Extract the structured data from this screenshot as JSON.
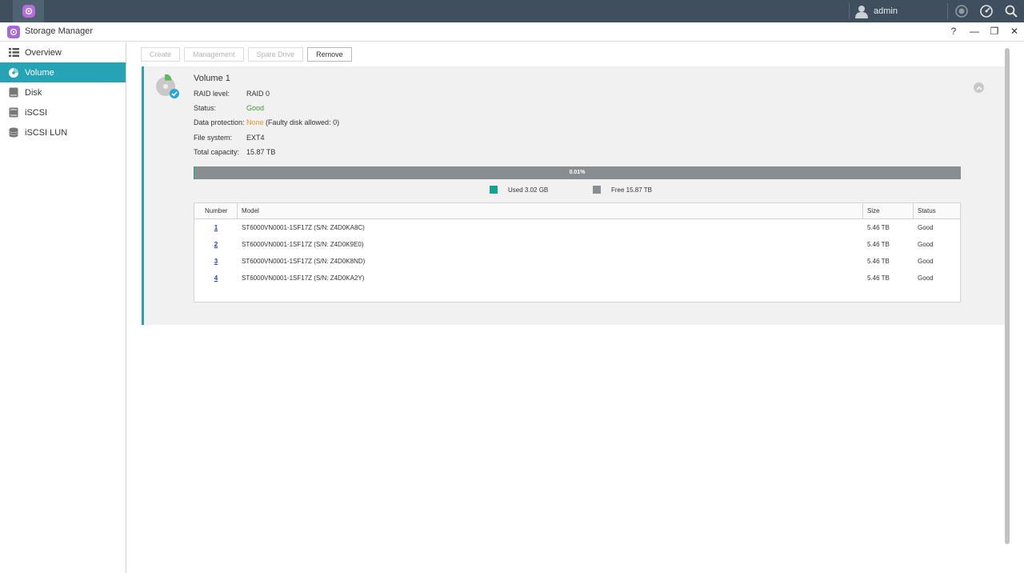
{
  "taskbar": {
    "user_name": "admin"
  },
  "window": {
    "title": "Storage Manager",
    "help_glyph": "?",
    "minimize_glyph": "—",
    "restore_glyph": "❐",
    "close_glyph": "✕"
  },
  "sidebar": {
    "items": [
      {
        "label": "Overview",
        "icon": "overview-icon"
      },
      {
        "label": "Volume",
        "icon": "volume-icon",
        "active": true
      },
      {
        "label": "Disk",
        "icon": "disk-icon"
      },
      {
        "label": "iSCSI",
        "icon": "iscsi-icon"
      },
      {
        "label": "iSCSI LUN",
        "icon": "iscsi-lun-icon"
      }
    ]
  },
  "toolbar": {
    "create": "Create",
    "management": "Management",
    "spare_drive": "Spare Drive",
    "remove": "Remove"
  },
  "volume": {
    "title": "Volume 1",
    "raid_level_label": "RAID level:",
    "raid_level": "RAID 0",
    "status_label": "Status:",
    "status": "Good",
    "data_protection_label": "Data protection:",
    "data_protection": "None",
    "data_protection_note": "(Faulty disk allowed: 0)",
    "file_system_label": "File system:",
    "file_system": "EXT4",
    "total_capacity_label": "Total capacity:",
    "total_capacity": "15.87 TB",
    "usage_percent_label": "0.01%",
    "usage_fraction": 0.0001,
    "used_label": "Used 3.02 GB",
    "free_label": "Free 15.87 TB"
  },
  "disk_table": {
    "headers": {
      "number": "Number",
      "model": "Model",
      "size": "Size",
      "status": "Status"
    },
    "rows": [
      {
        "number": "1",
        "model": "ST6000VN0001-1SF17Z (S/N: Z4D0KA8C)",
        "size": "5.46 TB",
        "status": "Good"
      },
      {
        "number": "2",
        "model": "ST6000VN0001-1SF17Z (S/N: Z4D0K9E0)",
        "size": "5.46 TB",
        "status": "Good"
      },
      {
        "number": "3",
        "model": "ST6000VN0001-1SF17Z (S/N: Z4D0K8ND)",
        "size": "5.46 TB",
        "status": "Good"
      },
      {
        "number": "4",
        "model": "ST6000VN0001-1SF17Z (S/N: Z4D0KA2Y)",
        "size": "5.46 TB",
        "status": "Good"
      }
    ]
  },
  "colors": {
    "accent": "#26a3b5",
    "used": "#16a292",
    "free": "#888d91",
    "good": "#3c9a35",
    "warning": "#e8962e",
    "app_icon": "#a868d8"
  }
}
